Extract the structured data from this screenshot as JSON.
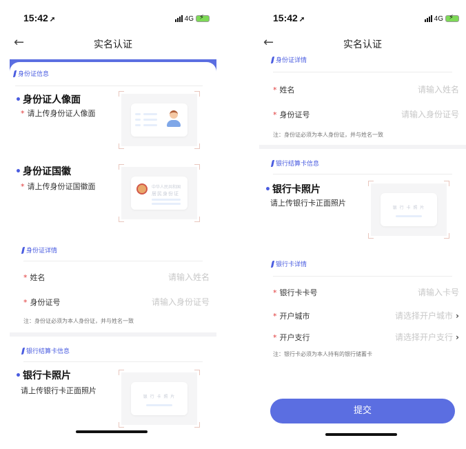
{
  "status": {
    "time": "15:42",
    "network": "4G"
  },
  "nav": {
    "title": "实名认证"
  },
  "left": {
    "id_info_header": "身份证信息",
    "front": {
      "title": "身份证人像面",
      "hint": "请上传身份证人像面"
    },
    "back": {
      "title": "身份证国徽",
      "hint": "请上传身份证国徽面"
    },
    "id_detail_header": "身份证详情",
    "name": {
      "label": "姓名",
      "placeholder": "请输入姓名"
    },
    "idnum": {
      "label": "身份证号",
      "placeholder": "请输入身份证号"
    },
    "note": "注：身份证必须为本人身份证，并与姓名一致",
    "bank_info_header": "银行结算卡信息",
    "bank_photo": {
      "title": "银行卡照片",
      "hint": "请上传银行卡正面照片",
      "card_text": "银 行 卡 照 片"
    }
  },
  "right": {
    "id_detail_header": "身份证详情",
    "name": {
      "label": "姓名",
      "placeholder": "请输入姓名"
    },
    "idnum": {
      "label": "身份证号",
      "placeholder": "请输入身份证号"
    },
    "note": "注：身份证必须为本人身份证，并与姓名一致",
    "bank_info_header": "银行结算卡信息",
    "bank_photo": {
      "title": "银行卡照片",
      "hint": "请上传银行卡正面照片",
      "card_text": "银 行 卡 照 片"
    },
    "bank_detail_header": "银行卡详情",
    "card_no": {
      "label": "银行卡卡号",
      "placeholder": "请输入卡号"
    },
    "city": {
      "label": "开户城市",
      "placeholder": "请选择开户城市"
    },
    "branch": {
      "label": "开户支行",
      "placeholder": "请选择开户支行"
    },
    "bank_note": "注：银行卡必须为本人持有的银行储蓄卡",
    "submit": "提交"
  },
  "illustration_text": {
    "emblem_line1": "中华人民共和国",
    "emblem_line2": "居民身份证"
  },
  "colors": {
    "accent": "#5b6ee1",
    "required": "#e03a3a"
  }
}
